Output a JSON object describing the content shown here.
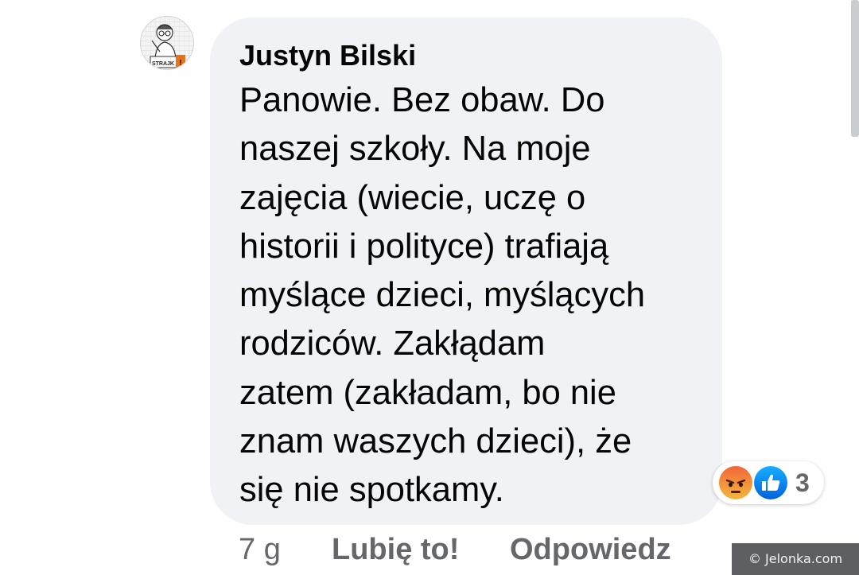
{
  "comment": {
    "author": "Justyn Bilski",
    "avatar_caption": "STRAJK!",
    "text_lines": [
      "Panowie. Bez obaw. Do",
      "naszej szkoły. Na moje",
      "zajęcia (wiecie, uczę o",
      "historii i polityce) trafiają",
      "myślące dzieci, myślących",
      "rodziców. Zakłądam",
      "zatem (zakładam, bo nie",
      "znam waszych dzieci), że",
      "się nie spotkamy."
    ]
  },
  "reactions": {
    "icons": [
      "angry-icon",
      "like-icon"
    ],
    "count": "3",
    "angry_color": "#f0663a",
    "like_color": "#1877f2"
  },
  "actions": {
    "time": "7 g",
    "like_label": "Lubię to!",
    "reply_label": "Odpowiedz"
  },
  "watermark": "© Jelonka.com"
}
